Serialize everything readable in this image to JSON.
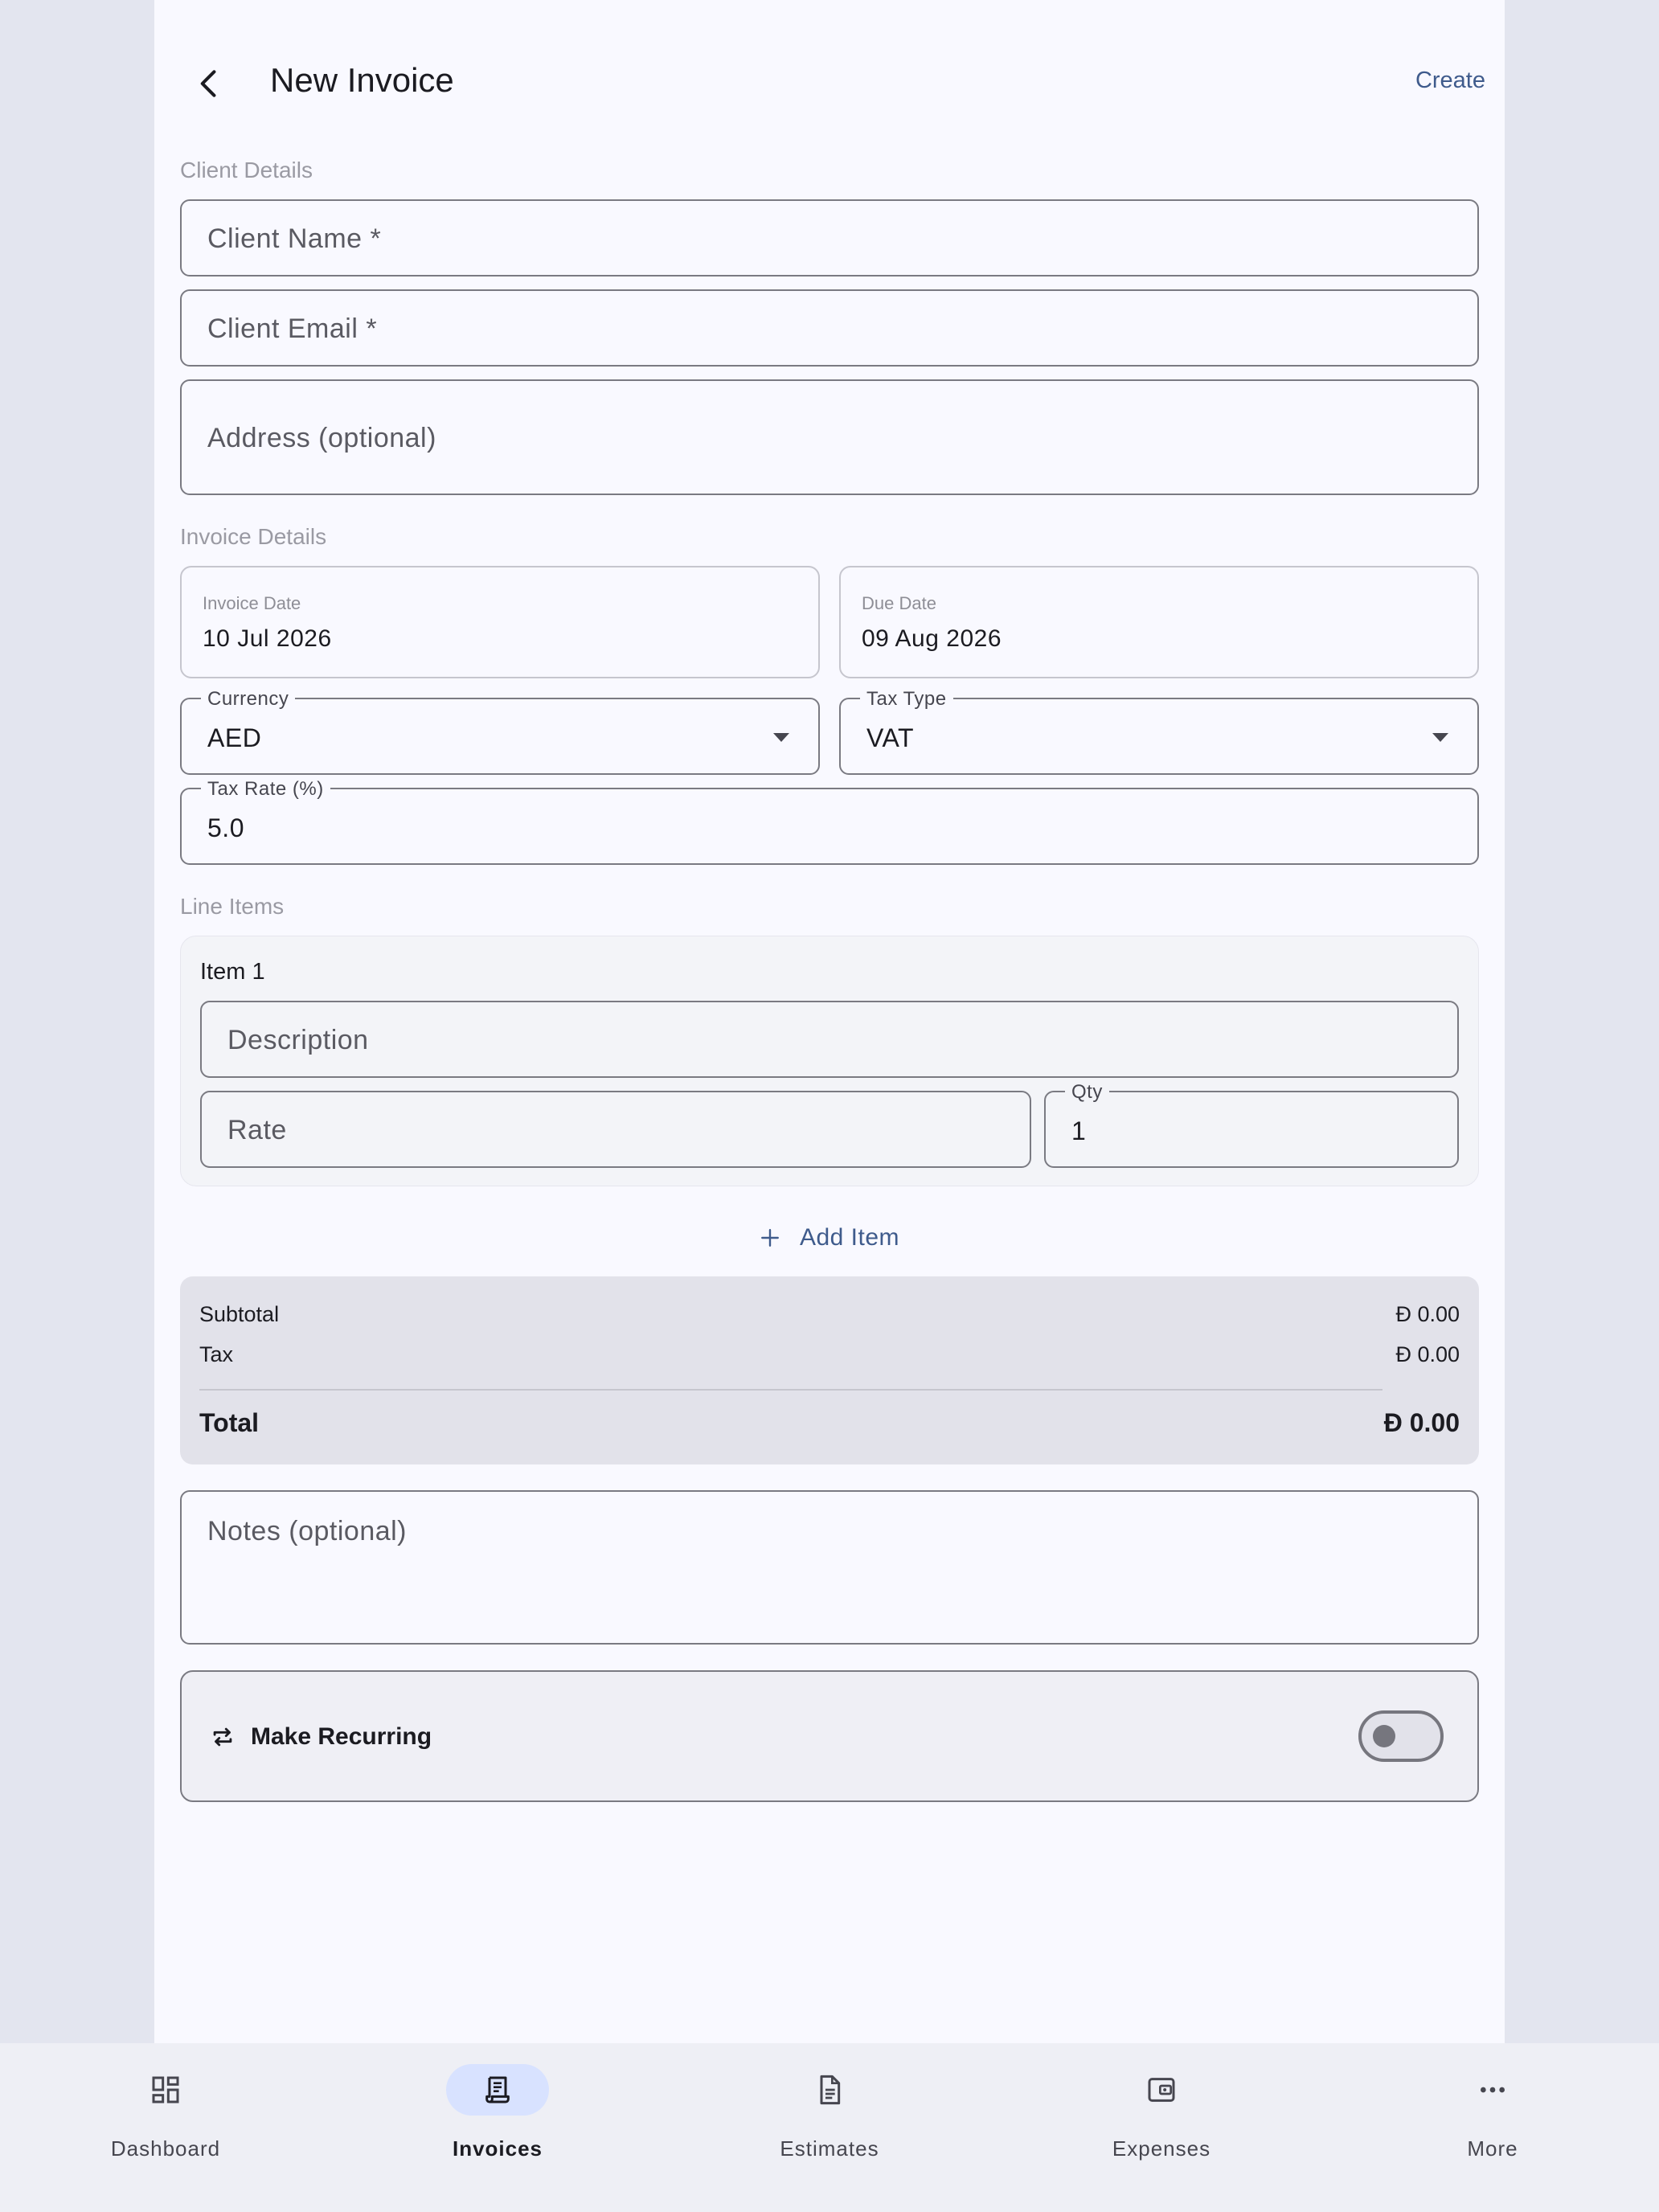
{
  "header": {
    "title": "New Invoice",
    "create_label": "Create"
  },
  "client_details": {
    "section_label": "Client Details",
    "client_name_placeholder": "Client Name *",
    "client_email_placeholder": "Client Email *",
    "address_placeholder": "Address (optional)"
  },
  "invoice_details": {
    "section_label": "Invoice Details",
    "invoice_date_label": "Invoice Date",
    "invoice_date_value": "10 Jul 2026",
    "due_date_label": "Due Date",
    "due_date_value": "09 Aug 2026",
    "currency_label": "Currency",
    "currency_value": "AED",
    "tax_type_label": "Tax Type",
    "tax_type_value": "VAT",
    "tax_rate_label": "Tax Rate (%)",
    "tax_rate_value": "5.0"
  },
  "line_items": {
    "section_label": "Line Items",
    "items": [
      {
        "title": "Item 1",
        "description_placeholder": "Description",
        "rate_placeholder": "Rate",
        "qty_label": "Qty",
        "qty_value": "1"
      }
    ],
    "add_item_label": "Add Item"
  },
  "totals": {
    "subtotal_label": "Subtotal",
    "subtotal_value": "Đ 0.00",
    "tax_label": "Tax",
    "tax_value": "Đ 0.00",
    "total_label": "Total",
    "total_value": "Đ 0.00"
  },
  "notes": {
    "placeholder": "Notes (optional)"
  },
  "recurring": {
    "label": "Make Recurring",
    "enabled": false
  },
  "bottom_nav": {
    "items": [
      {
        "label": "Dashboard",
        "icon": "dashboard-icon",
        "active": false
      },
      {
        "label": "Invoices",
        "icon": "receipt-icon",
        "active": true
      },
      {
        "label": "Estimates",
        "icon": "document-icon",
        "active": false
      },
      {
        "label": "Expenses",
        "icon": "wallet-icon",
        "active": false
      },
      {
        "label": "More",
        "icon": "more-horizontal-icon",
        "active": false
      }
    ]
  },
  "colors": {
    "accent": "#3f5b8c",
    "nav_active_pill": "#d8e2ff",
    "page_background": "#f9f9ff",
    "outer_background": "#e3e5ef"
  }
}
